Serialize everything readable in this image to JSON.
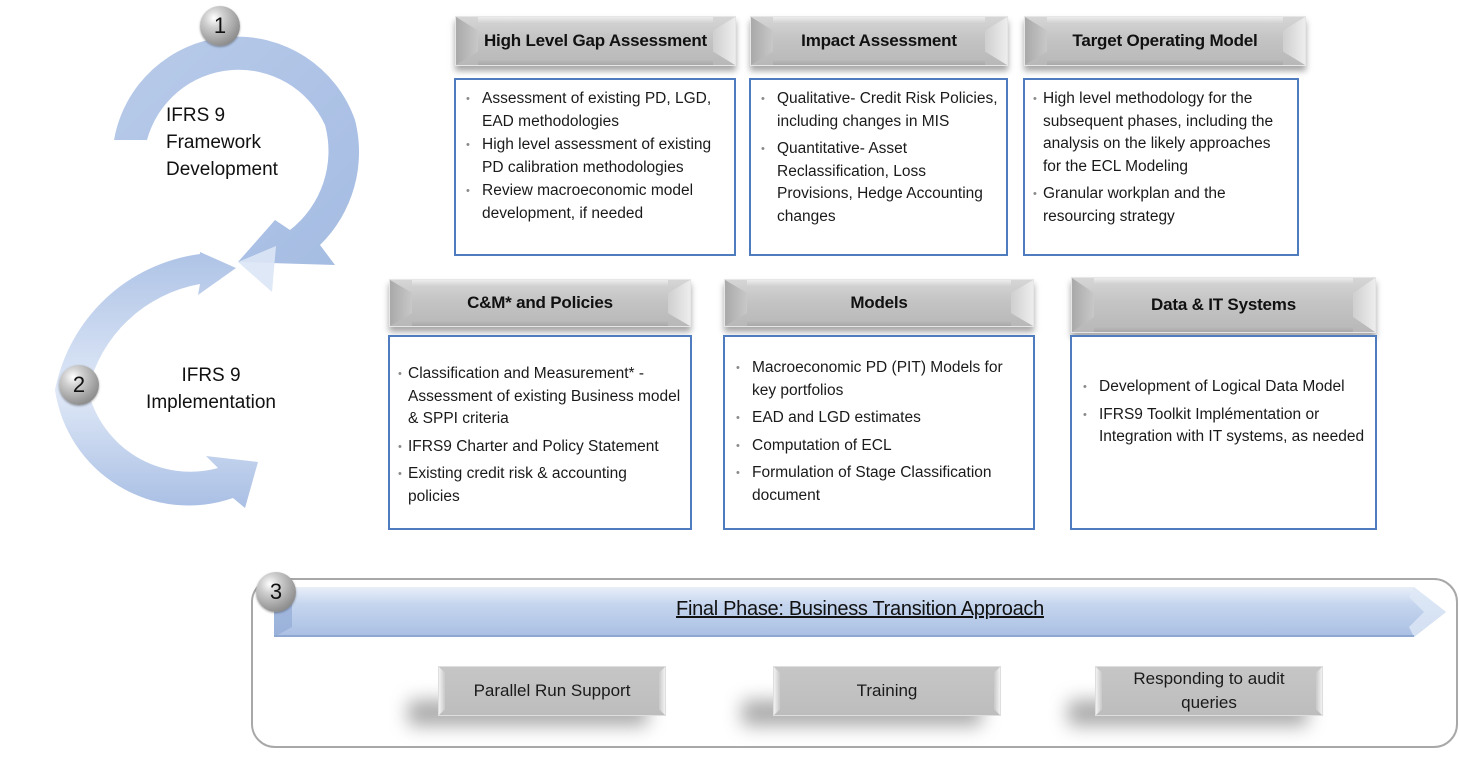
{
  "cycle": {
    "phase1": {
      "number": "1",
      "label_lines": [
        "IFRS 9",
        "Framework",
        "Development"
      ]
    },
    "phase2": {
      "number": "2",
      "label_lines": [
        "IFRS 9",
        "Implementation"
      ]
    },
    "arrow_color": "#aec3e6"
  },
  "phase1_columns": [
    {
      "title": "High Level Gap Assessment",
      "items": [
        "Assessment of existing PD, LGD, EAD methodologies",
        "High level assessment of existing PD calibration methodologies",
        "Review macroeconomic model development, if needed"
      ]
    },
    {
      "title": "Impact Assessment",
      "items": [
        "Qualitative-  Credit Risk Policies, including changes in MIS",
        "Quantitative- Asset Reclassification, Loss Provisions, Hedge Accounting changes"
      ]
    },
    {
      "title": "Target Operating Model",
      "items": [
        "High level methodology for the subsequent phases, including the analysis on the likely approaches for the ECL Modeling",
        "Granular workplan and the resourcing strategy"
      ]
    }
  ],
  "phase2_columns": [
    {
      "title": "C&M* and Policies",
      "items": [
        "Classification and Measurement* - Assessment of existing Business model & SPPI criteria",
        "IFRS9 Charter and Policy Statement",
        "Existing credit risk & accounting policies"
      ]
    },
    {
      "title": "Models",
      "items": [
        "Macroeconomic PD (PIT) Models for key portfolios",
        "EAD and LGD estimates",
        "Computation of ECL",
        "Formulation of Stage Classification document"
      ]
    },
    {
      "title": "Data & IT Systems",
      "items": [
        "Development of Logical Data Model",
        "IFRS9 Toolkit Implémentation or Integration with IT systems, as needed"
      ]
    }
  ],
  "final_phase": {
    "number": "3",
    "title": "Final Phase: Business Transition Approach",
    "activities": [
      "Parallel Run Support",
      "Training",
      "Responding to audit queries"
    ]
  },
  "colors": {
    "box_border": "#4f7bbf",
    "banner_blue": "#b4c8e8",
    "header_gray": "#c4c4c4"
  }
}
